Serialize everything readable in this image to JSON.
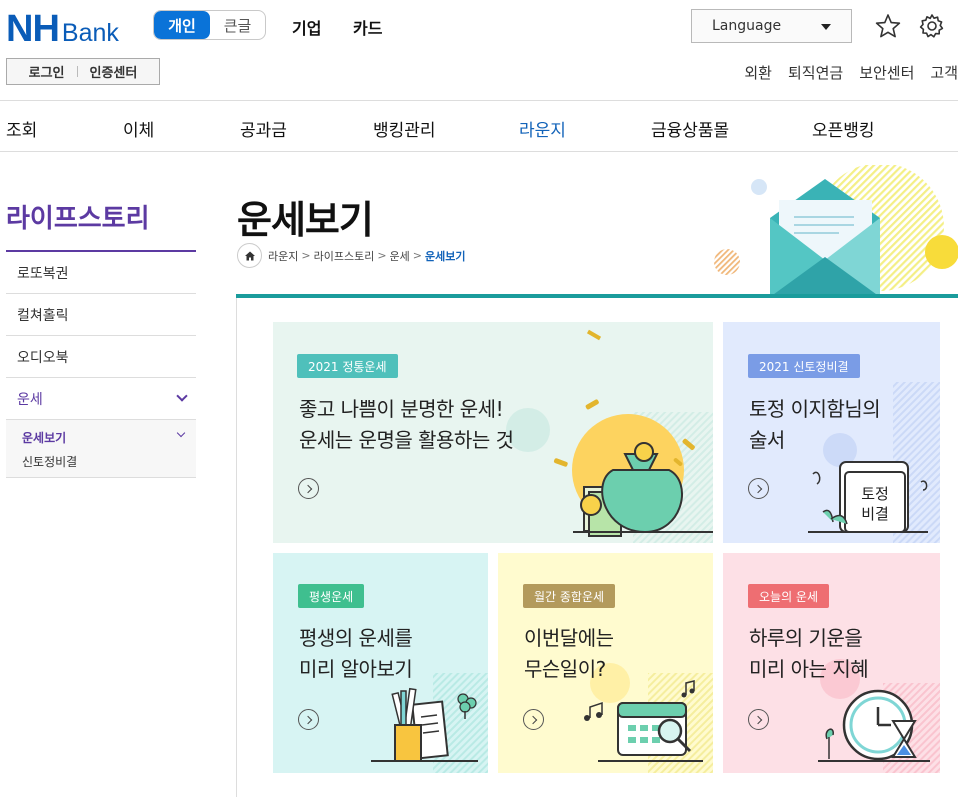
{
  "header": {
    "logo_main": "NH",
    "logo_sub": "Bank",
    "segment": {
      "active": "개인",
      "inactive": "큰글"
    },
    "top_menu": [
      "기업",
      "카드"
    ],
    "language_label": "Language",
    "login": "로그인",
    "cert_center": "인증센터",
    "utility_links": [
      "외환",
      "퇴직연금",
      "보안센터",
      "고객"
    ]
  },
  "gnb": {
    "items": [
      "조회",
      "이체",
      "공과금",
      "뱅킹관리",
      "라운지",
      "금융상품몰",
      "오픈뱅킹"
    ],
    "active": "라운지"
  },
  "lnb": {
    "title": "라이프스토리",
    "items": [
      "로또복권",
      "컬쳐홀릭",
      "오디오북",
      "운세"
    ],
    "sub_items": [
      "운세보기",
      "신토정비결"
    ]
  },
  "page": {
    "title": "운세보기",
    "breadcrumb": [
      "라운지",
      "라이프스토리",
      "운세",
      "운세보기"
    ]
  },
  "cards": [
    {
      "badge": "2021 정통운세",
      "title": "좋고 나쁨이 분명한 운세!\n운세는 운명을 활용하는 것",
      "bg": "#e8f5f0",
      "badge_color": "#4fc0bb"
    },
    {
      "badge": "2021 신토정비결",
      "title": "토정 이지함님의\n술서",
      "bg": "#e1eafd",
      "badge_color": "#7a9ce6",
      "art_text": [
        "토정",
        "비결"
      ]
    },
    {
      "badge": "평생운세",
      "title": "평생의 운세를\n미리 알아보기",
      "bg": "#d7f4f3",
      "badge_color": "#3fbf8f"
    },
    {
      "badge": "월간 종합운세",
      "title": "이번달에는\n무슨일이?",
      "bg": "#fffbcf",
      "badge_color": "#b39a5c"
    },
    {
      "badge": "오늘의 운세",
      "title": "하루의 기운을\n미리 아는 지혜",
      "bg": "#fde0e6",
      "badge_color": "#ee6e72"
    }
  ],
  "colors": {
    "brand": "#0a5cb8",
    "accent_purple": "#5c3aa2",
    "teal": "#1a9c9c"
  }
}
